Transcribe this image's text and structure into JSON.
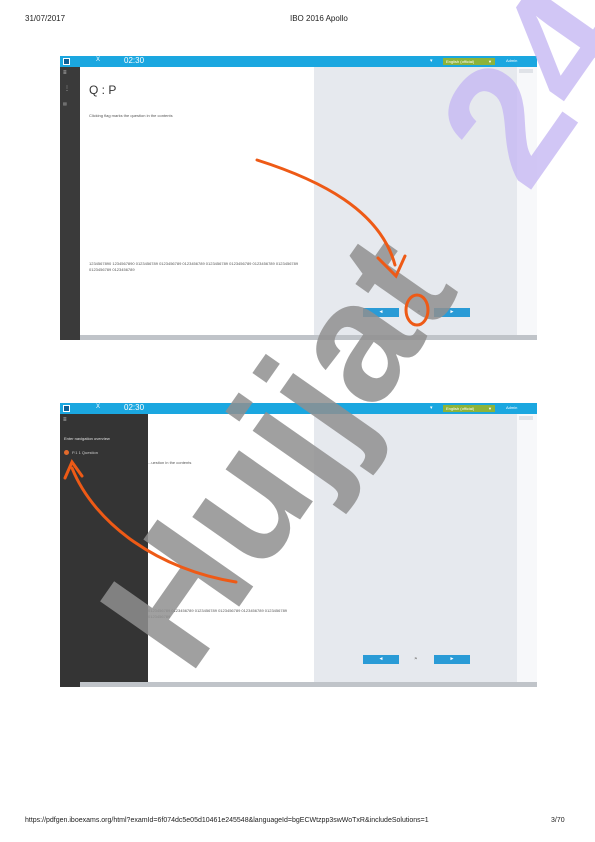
{
  "header": {
    "date": "31/07/2017",
    "title": "IBO 2016 Apollo"
  },
  "screenshot1": {
    "exam_bar": {
      "close": "X",
      "timer": "02:30",
      "language": "English (official)",
      "user": "Admin"
    },
    "question_title": "Q : P",
    "question_text": "Clicking flag marks the question in the contents",
    "digits_text": "1234567890 1234567890 0123456789 0123456789 0123456789 0123456789 0123456789 0123456789 0123456789 0123456789 0123456789",
    "prev_label": "◄",
    "next_label": "►"
  },
  "screenshot2": {
    "exam_bar": {
      "close": "X",
      "timer": "02:30",
      "language": "English (official)",
      "user": "Admin"
    },
    "panel_title": "Enter navigation overview",
    "panel_item": "P.1 1 Question",
    "question_text": "...uestion in the contents",
    "digits_text": "0123456789 0123456789 0123456789 0123456789 0123456789 0123456789 0123456789",
    "prev_label": "◄",
    "next_label": "►"
  },
  "watermark": {
    "text": "Hujjat24",
    "purple_part": "24",
    "gray_part": "Hujjat",
    "colors": {
      "purple": "#c6b8f2",
      "gray": "#8f8f8f"
    }
  },
  "annotations": {
    "arrow_color": "#ee5a16"
  },
  "footer": {
    "url": "https://pdfgen.iboexams.org/html?examId=6f074dc5e05d10461e245548&languageId=bgECWtzpp3swWoTxR&includeSolutions=1",
    "page": "3/70"
  }
}
